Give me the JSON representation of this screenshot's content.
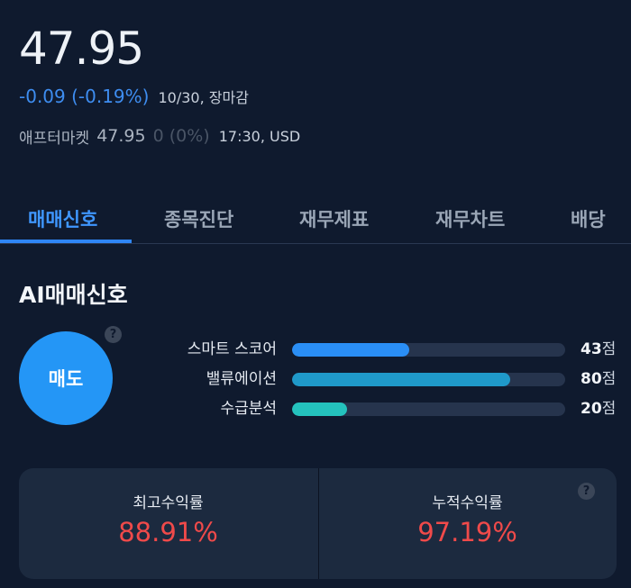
{
  "quote": {
    "price": "47.95",
    "change": "-0.09 (-0.19%)",
    "date_status": "10/30, 장마감",
    "after_label": "애프터마켓",
    "after_price": "47.95",
    "after_change": "0 (0%)",
    "after_time": "17:30, USD"
  },
  "tabs": [
    {
      "label": "매매신호",
      "active": true
    },
    {
      "label": "종목진단",
      "active": false
    },
    {
      "label": "재무제표",
      "active": false
    },
    {
      "label": "재무차트",
      "active": false
    },
    {
      "label": "배당",
      "active": false
    }
  ],
  "ai_signal": {
    "title": "AI매매신호",
    "signal": "매도",
    "help": "?",
    "metrics": [
      {
        "label": "스마트 스코어",
        "value": "43",
        "unit": "점",
        "score": 43,
        "color": "#2a8ef5"
      },
      {
        "label": "밸류에이션",
        "value": "80",
        "unit": "점",
        "score": 80,
        "color": "#1f99c9"
      },
      {
        "label": "수급분석",
        "value": "20",
        "unit": "점",
        "score": 20,
        "color": "#24c2bd"
      }
    ]
  },
  "returns": {
    "max_label": "최고수익률",
    "max_value": "88.91%",
    "cum_label": "누적수익률",
    "cum_value": "97.19%",
    "help": "?"
  },
  "colors": {
    "accent": "#2f86f6",
    "negative": "#3e8df0",
    "returns": "#f04a4a",
    "background": "#0f1a2e"
  }
}
